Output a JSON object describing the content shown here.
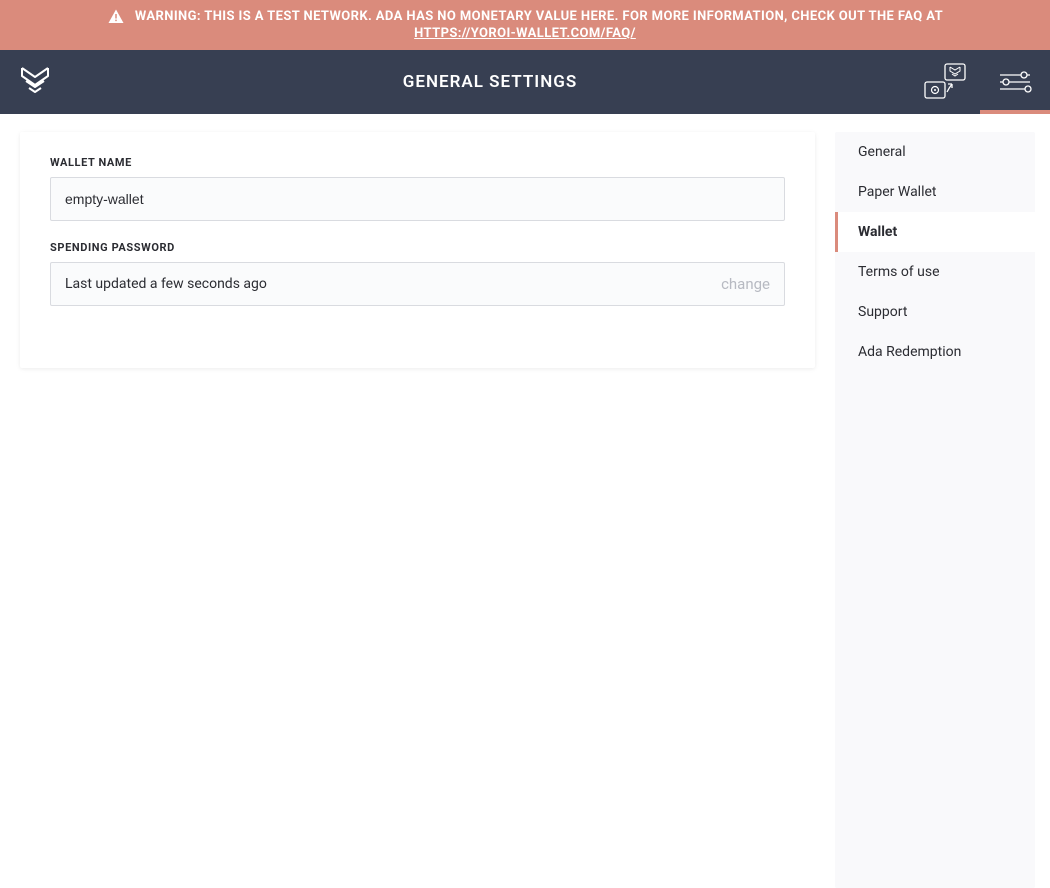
{
  "banner": {
    "warning_text": "WARNING: THIS IS A TEST NETWORK. ADA HAS NO MONETARY VALUE HERE. FOR MORE INFORMATION, CHECK OUT THE FAQ AT",
    "faq_url_text": "HTTPS://YOROI-WALLET.COM/FAQ/"
  },
  "header": {
    "title": "GENERAL SETTINGS"
  },
  "main": {
    "wallet_name_label": "WALLET NAME",
    "wallet_name_value": "empty-wallet",
    "spending_password_label": "SPENDING PASSWORD",
    "spending_password_status": "Last updated a few seconds ago",
    "change_label": "change"
  },
  "sidebar": {
    "items": [
      {
        "label": "General",
        "active": false
      },
      {
        "label": "Paper Wallet",
        "active": false
      },
      {
        "label": "Wallet",
        "active": true
      },
      {
        "label": "Terms of use",
        "active": false
      },
      {
        "label": "Support",
        "active": false
      },
      {
        "label": "Ada Redemption",
        "active": false
      }
    ]
  },
  "colors": {
    "accent": "#da8b7c",
    "header_bg": "#373f52"
  }
}
